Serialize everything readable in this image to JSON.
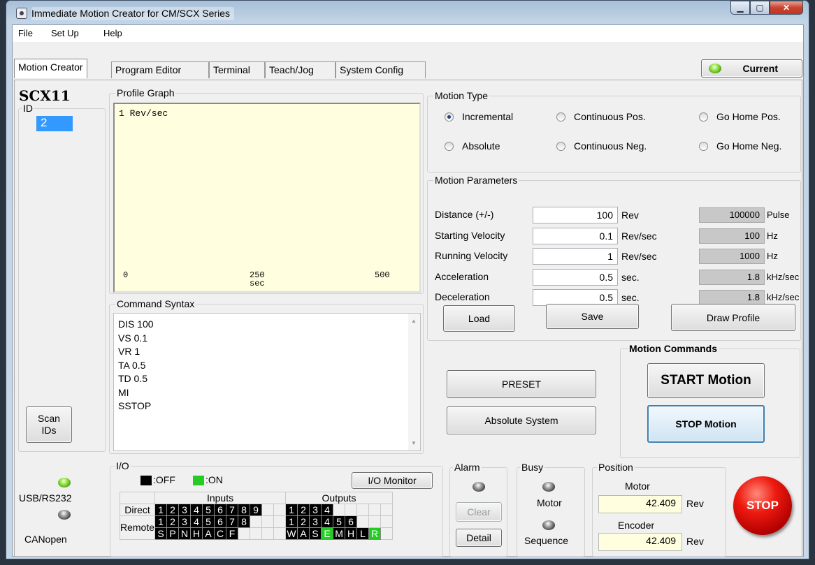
{
  "window": {
    "title": "Immediate Motion Creator for CM/SCX Series"
  },
  "menu": {
    "file": "File",
    "setup": "Set Up",
    "help": "Help"
  },
  "tabs": [
    "Motion Creator",
    "Program Editor",
    "Terminal",
    "Teach/Jog",
    "System Config"
  ],
  "current_button": "Current",
  "device": {
    "model": "SCX11",
    "id_label": "ID",
    "selected_id": "2",
    "scan_label_1": "Scan",
    "scan_label_2": "IDs"
  },
  "profile_graph": {
    "label": "Profile Graph",
    "y_label": "1 Rev/sec",
    "ticks": [
      "0",
      "250",
      "500"
    ],
    "x_unit": "sec"
  },
  "command_syntax": {
    "label": "Command Syntax",
    "lines": [
      "DIS 100",
      "VS 0.1",
      "VR 1",
      "TA 0.5",
      "TD 0.5",
      "MI",
      "SSTOP"
    ]
  },
  "motion_type": {
    "label": "Motion Type",
    "options": [
      {
        "label": "Incremental",
        "selected": true
      },
      {
        "label": "Continuous Pos.",
        "selected": false
      },
      {
        "label": "Go Home Pos.",
        "selected": false
      },
      {
        "label": "Absolute",
        "selected": false
      },
      {
        "label": "Continuous Neg.",
        "selected": false
      },
      {
        "label": "Go Home Neg.",
        "selected": false
      }
    ]
  },
  "motion_params": {
    "label": "Motion Parameters",
    "rows": [
      {
        "name": "Distance (+/-)",
        "value": "100",
        "unit": "Rev",
        "conv": "100000",
        "conv_unit": "Pulse"
      },
      {
        "name": "Starting Velocity",
        "value": "0.1",
        "unit": "Rev/sec",
        "conv": "100",
        "conv_unit": "Hz"
      },
      {
        "name": "Running Velocity",
        "value": "1",
        "unit": "Rev/sec",
        "conv": "1000",
        "conv_unit": "Hz"
      },
      {
        "name": "Acceleration",
        "value": "0.5",
        "unit": "sec.",
        "conv": "1.8",
        "conv_unit": "kHz/sec"
      },
      {
        "name": "Deceleration",
        "value": "0.5",
        "unit": "sec.",
        "conv": "1.8",
        "conv_unit": "kHz/sec"
      }
    ],
    "load": "Load",
    "save": "Save",
    "draw": "Draw Profile"
  },
  "motion_commands": {
    "label": "Motion Commands",
    "start": "START Motion",
    "stop": "STOP Motion",
    "preset": "PRESET",
    "absolute": "Absolute System"
  },
  "connection": {
    "usb": "USB/RS232",
    "canopen": "CANopen"
  },
  "io": {
    "label": "I/O",
    "off": ":OFF",
    "on": ":ON",
    "monitor": "I/O Monitor",
    "inputs": "Inputs",
    "outputs": "Outputs",
    "direct": "Direct",
    "remote": "Remote"
  },
  "alarm": {
    "label": "Alarm",
    "clear": "Clear",
    "detail": "Detail"
  },
  "busy": {
    "label": "Busy",
    "motor": "Motor",
    "sequence": "Sequence"
  },
  "position": {
    "label": "Position",
    "motor": "Motor",
    "motor_value": "42.409",
    "encoder": "Encoder",
    "encoder_value": "42.409",
    "unit": "Rev"
  },
  "stop_button": "STOP",
  "colors": {
    "led_green": "#8ee03c",
    "io_on": "#22cc22",
    "graph_bg": "#ffffe0",
    "selection": "#3399ff",
    "stop_red": "#e01010"
  }
}
